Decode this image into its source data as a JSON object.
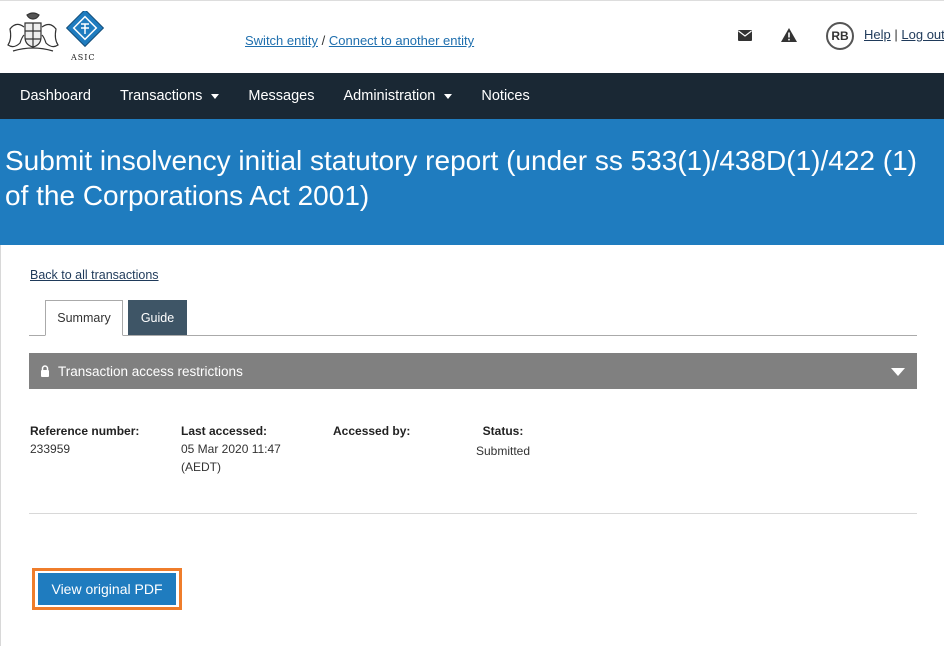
{
  "header": {
    "logo_text": "ASIC",
    "switch_entity": "Switch entity",
    "separator": "/",
    "connect_entity": "Connect to another entity",
    "avatar_initials": "RB",
    "help": "Help",
    "pipe": "|",
    "logout": "Log out"
  },
  "nav": {
    "items": [
      {
        "label": "Dashboard",
        "dropdown": false
      },
      {
        "label": "Transactions",
        "dropdown": true
      },
      {
        "label": "Messages",
        "dropdown": false
      },
      {
        "label": "Administration",
        "dropdown": true
      },
      {
        "label": "Notices",
        "dropdown": false
      }
    ]
  },
  "banner": {
    "title": "Submit insolvency initial statutory report (under ss 533(1)/438D(1)/422 (1) of the Corporations Act 2001)"
  },
  "content": {
    "back_link": "Back to all transactions",
    "tabs": [
      "Summary",
      "Guide"
    ],
    "restrictions_label": "Transaction access restrictions",
    "fields": {
      "reference_label": "Reference number:",
      "reference_value": "233959",
      "last_accessed_label": "Last accessed:",
      "last_accessed_value": "05 Mar 2020 11:47 (AEDT)",
      "accessed_by_label": "Accessed by:",
      "accessed_by_value": "",
      "status_label": "Status:",
      "status_value": "Submitted"
    },
    "pdf_button": "View original PDF"
  },
  "colors": {
    "nav_bg": "#1a2834",
    "banner_bg": "#1f7cbf",
    "guide_tab_bg": "#3e5566",
    "restrictions_bg": "#808080",
    "highlight": "#ef7d2b"
  }
}
